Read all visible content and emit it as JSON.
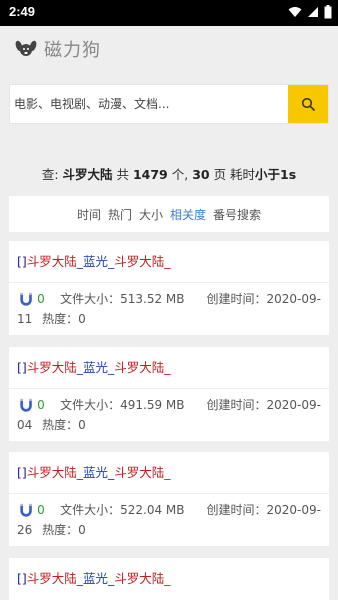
{
  "status": {
    "time": "2:49"
  },
  "app": {
    "name": "磁力狗"
  },
  "search": {
    "placeholder": "电影、电视剧、动漫、文档..."
  },
  "summary": {
    "prefix": "查: ",
    "query": "斗罗大陆",
    "mid1": " 共 ",
    "count": "1479",
    "mid2": " 个, ",
    "pages": "30",
    "mid3": " 页 耗时",
    "time": "小于1s"
  },
  "sort": {
    "items": [
      "时间",
      "热门",
      "大小",
      "相关度",
      "番号搜索"
    ],
    "active": "相关度"
  },
  "results": [
    {
      "title_bracket": "[]",
      "title_a": "斗罗大陆",
      "title_sep": "_蓝光_",
      "title_b": "斗罗大陆_",
      "magnets": "0",
      "size": "文件大小：513.52 MB",
      "created_a": "创建时间：2020-09-",
      "created_b": "11",
      "heat": "热度：0"
    },
    {
      "title_bracket": "[]",
      "title_a": "斗罗大陆",
      "title_sep": "_蓝光_",
      "title_b": "斗罗大陆_",
      "magnets": "0",
      "size": "文件大小：491.59 MB",
      "created_a": "创建时间：2020-09-",
      "created_b": "04",
      "heat": "热度：0"
    },
    {
      "title_bracket": "[]",
      "title_a": "斗罗大陆",
      "title_sep": "_蓝光_",
      "title_b": "斗罗大陆_",
      "magnets": "0",
      "size": "文件大小：522.04 MB",
      "created_a": "创建时间：2020-09-",
      "created_b": "26",
      "heat": "热度：0"
    },
    {
      "title_bracket": "[]",
      "title_a": "斗罗大陆",
      "title_sep": "_蓝光_",
      "title_b": "斗罗大陆_"
    }
  ],
  "colors": {
    "accent": "#f7c800",
    "active_tab": "#3a7bd5",
    "magnet_count": "#2e9a2e"
  },
  "icons": {
    "logo": "dog-icon",
    "search": "search-icon",
    "magnet": "magnet-icon"
  }
}
